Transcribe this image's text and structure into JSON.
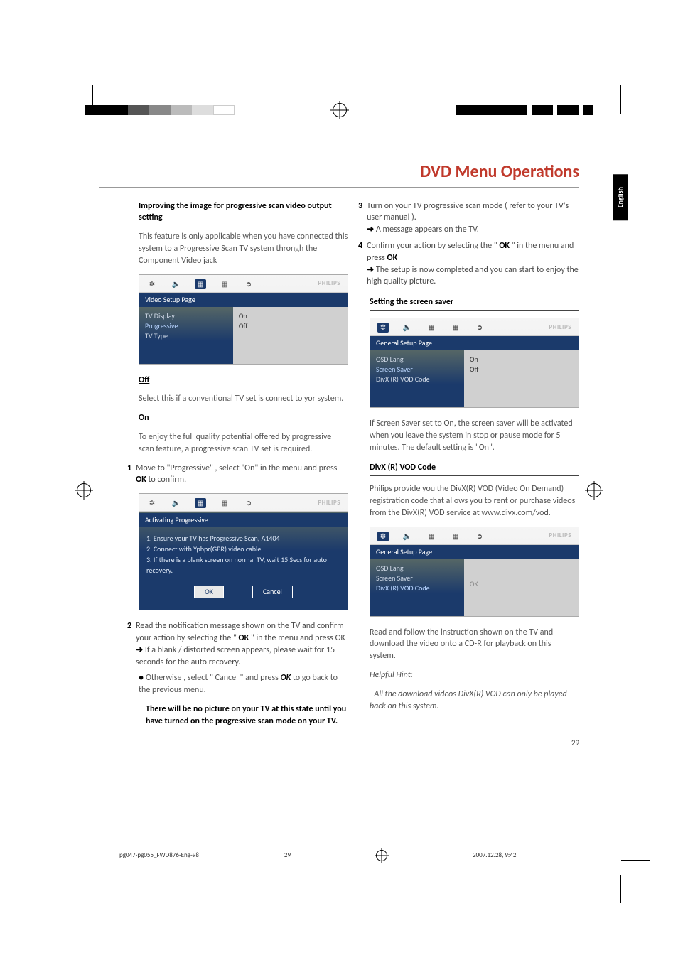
{
  "lang_tab": "English",
  "title": "DVD Menu Operations",
  "left": {
    "h1": "Improving the image for progressive scan video output setting",
    "p1": "This feature is only applicable when you have connected this system to a Progressive Scan TV system throngh the Component Video jack",
    "osd1": {
      "brand": "PHILIPS",
      "header": "Video Setup Page",
      "items": [
        "TV Display",
        "Progressive",
        "TV Type"
      ],
      "opts": [
        "On",
        "Off"
      ]
    },
    "off_h": "Off",
    "off_p": "Select this if a conventional TV set is connect to yor system.",
    "on_h": "On",
    "on_p": "To enjoy the full quality potential offered by progressive scan feature, a progressive scan TV set is required.",
    "s1_a": "Move to \"Progressive\" , select \"On\" in the menu and press ",
    "s1_ok": "OK",
    "s1_b": "  to confirm.",
    "osd2": {
      "brand": "PHILIPS",
      "header": "Activating Progressive",
      "l1": "1. Ensure your TV has Progressive Scan, A1404",
      "l2": "2. Connect with Ypbpr(GBR) video cable.",
      "l3": "3. If there is a blank screen on normal TV, wait 15 Secs for auto recovery.",
      "ok": "OK",
      "cancel": "Cancel"
    },
    "s2_a": "Read the notification message shown on the TV and confirm your action by selecting the \" ",
    "s2_ok": "OK",
    "s2_b": " \" in the menu and press OK",
    "s2_arrow": "If a blank / distorted screen appears, please wait for 15 seconds for the auto recovery.",
    "bullet_a": "Otherwise , select \" Cancel \" and press ",
    "bullet_ok": "OK",
    "bullet_b": " to go back to the previous menu.",
    "bold_note": "There will be no picture on your TV at this state until you have turned on the progressive scan mode on your  TV."
  },
  "right": {
    "s3_a": "Turn on your TV progressive scan mode ( refer to your  TV's user manual ).",
    "s3_arrow": "A message appears on the TV.",
    "s4_a": "Confirm your action by selecting the \" ",
    "s4_ok": "OK",
    "s4_b": " \"  in the menu and press ",
    "s4_ok2": "OK",
    "s4_arrow": "The setup is now completed and you can start to enjoy the high quality picture.",
    "sec1": "Setting the screen saver",
    "osd3": {
      "brand": "PHILIPS",
      "header": "General Setup Page",
      "items": [
        "OSD Lang",
        "Screen Saver",
        "DivX (R) VOD Code"
      ],
      "opts": [
        "On",
        "Off"
      ]
    },
    "ss_p": "If Screen Saver set to On, the screen saver will be activated when you leave the system in stop or pause mode for 5 minutes. The default setting is \"On\".",
    "sec2": "DivX (R)  VOD  Code",
    "divx_p": "Philips provide you the DivX(R) VOD (Video On Demand) registration code that allows you to rent or purchase videos from the DivX(R) VOD service at www.divx.com/vod.",
    "osd4": {
      "brand": "PHILIPS",
      "header": "General Setup Page",
      "items": [
        "OSD Lang",
        "Screen Saver",
        "DivX (R) VOD Code"
      ],
      "opts": [
        "OK"
      ]
    },
    "divx_p2": "Read and follow the instruction shown on the TV and download the video onto a CD-R for playback on this system.",
    "hint_h": "Helpful Hint:",
    "hint_p": "- All the download videos DivX(R) VOD can only be played back on this system."
  },
  "page_number": "29",
  "footer": {
    "file": "pg047-pg055_FWD876-Eng-98",
    "page": "29",
    "ts": "2007.12.28, 9:42"
  }
}
